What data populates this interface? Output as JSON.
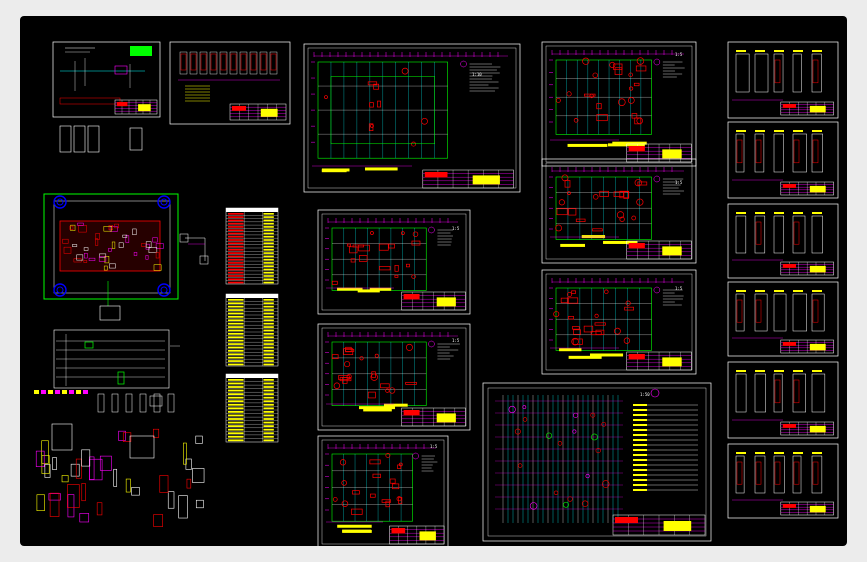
{
  "viewport": {
    "background": "#000000",
    "frame_background": "#ececec"
  },
  "palette": {
    "magenta": "#ff00ff",
    "yellow": "#ffff00",
    "red": "#ff0000",
    "green": "#00ff00",
    "blue": "#0000ff",
    "cyan": "#00ffff",
    "white": "#ffffff"
  },
  "sheets": {
    "s_main_plate": {
      "label": "1:10"
    },
    "s_mid1": {
      "label": "1:5"
    },
    "s_mid2": {
      "label": "1:5"
    },
    "s_mid3": {
      "label": "1:5"
    },
    "s_col1": {
      "label": "1:5"
    },
    "s_col2": {
      "label": "1:5"
    },
    "s_col3": {
      "label": "1:5"
    },
    "s_big": {
      "label": "1:50"
    }
  }
}
